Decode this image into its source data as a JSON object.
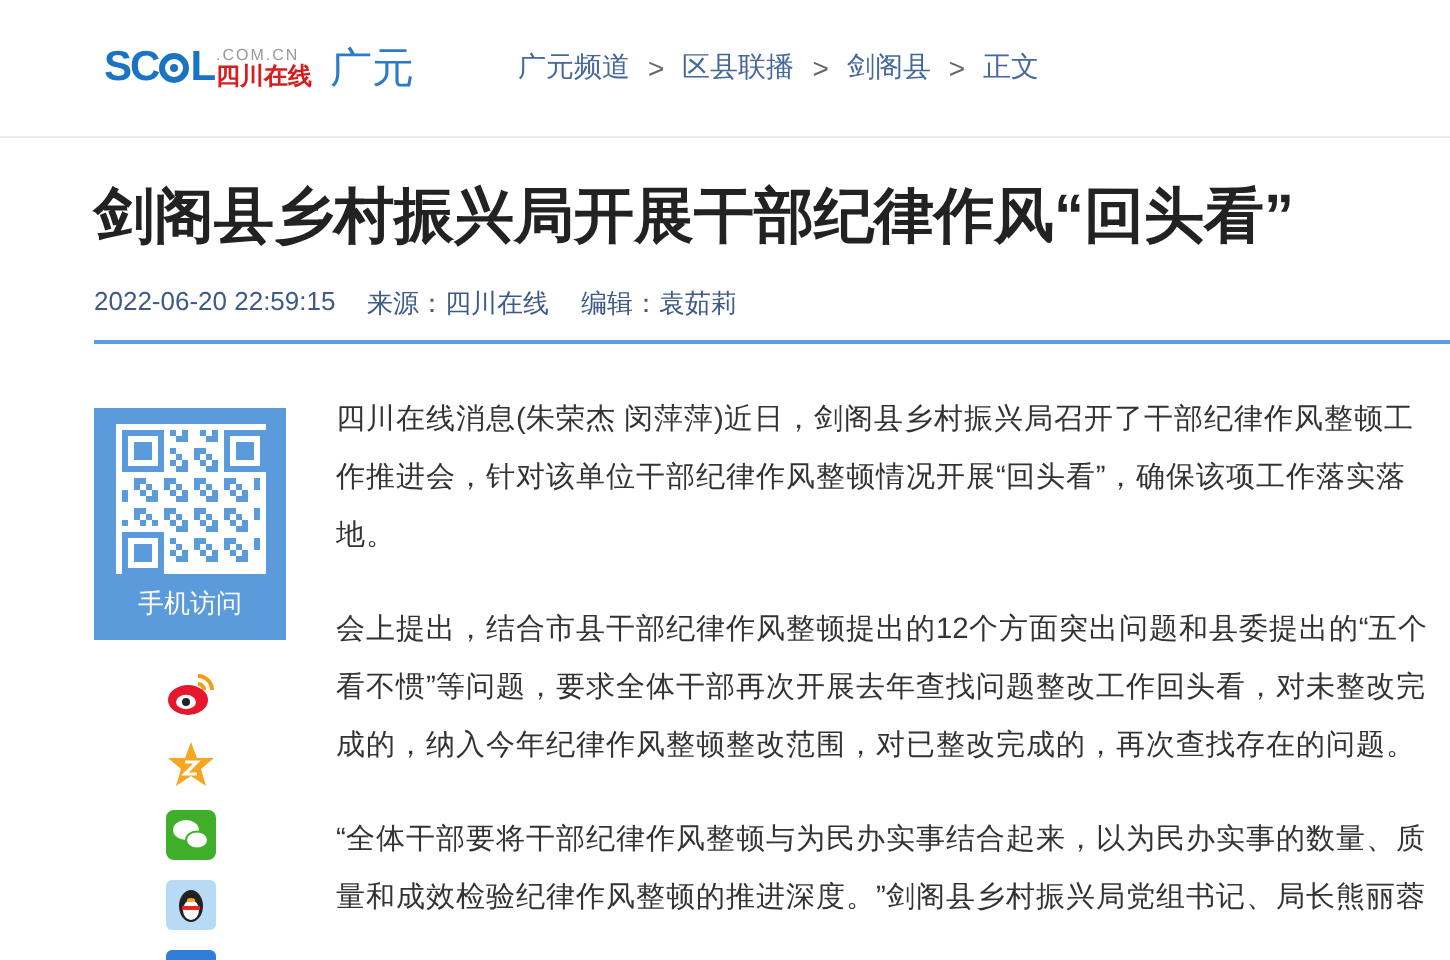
{
  "header": {
    "logo": {
      "left": "SC",
      "right": "L",
      "domain": ".COM.CN",
      "name": "四川在线"
    },
    "channel": "广元",
    "breadcrumb": {
      "separator": ">",
      "items": [
        "广元频道",
        "区县联播",
        "剑阁县",
        "正文"
      ]
    }
  },
  "article": {
    "title": "剑阁县乡村振兴局开展干部纪律作风“回头看”",
    "meta": {
      "date": "2022-06-20 22:59:15",
      "source": "来源：四川在线",
      "editor": "编辑：袁茹莉"
    },
    "qr": {
      "caption": "手机访问"
    },
    "share": [
      {
        "kind": "weibo"
      },
      {
        "kind": "qzone"
      },
      {
        "kind": "wechat"
      },
      {
        "kind": "qq"
      },
      {
        "kind": "more"
      }
    ],
    "paragraphs": [
      "四川在线消息(朱荣杰 闵萍萍)近日，剑阁县乡村振兴局召开了干部纪律作风整顿工作推进会，针对该单位干部纪律作风整顿情况开展“回头看”，确保该项工作落实落地。",
      "会上提出，结合市县干部纪律作风整顿提出的12个方面突出问题和县委提出的“五个看不惯”等问题，要求全体干部再次开展去年查找问题整改工作回头看，对未整改完成的，纳入今年纪律作风整顿整改范围，对已整改完成的，再次查找存在的问题。",
      "“全体干部要将干部纪律作风整顿与为民办实事结合起来，以为民办实事的数量、质量和成效检验纪律作风整顿的推进深度。”剑阁县乡村振兴局党组书记、局长熊丽蓉"
    ]
  }
}
